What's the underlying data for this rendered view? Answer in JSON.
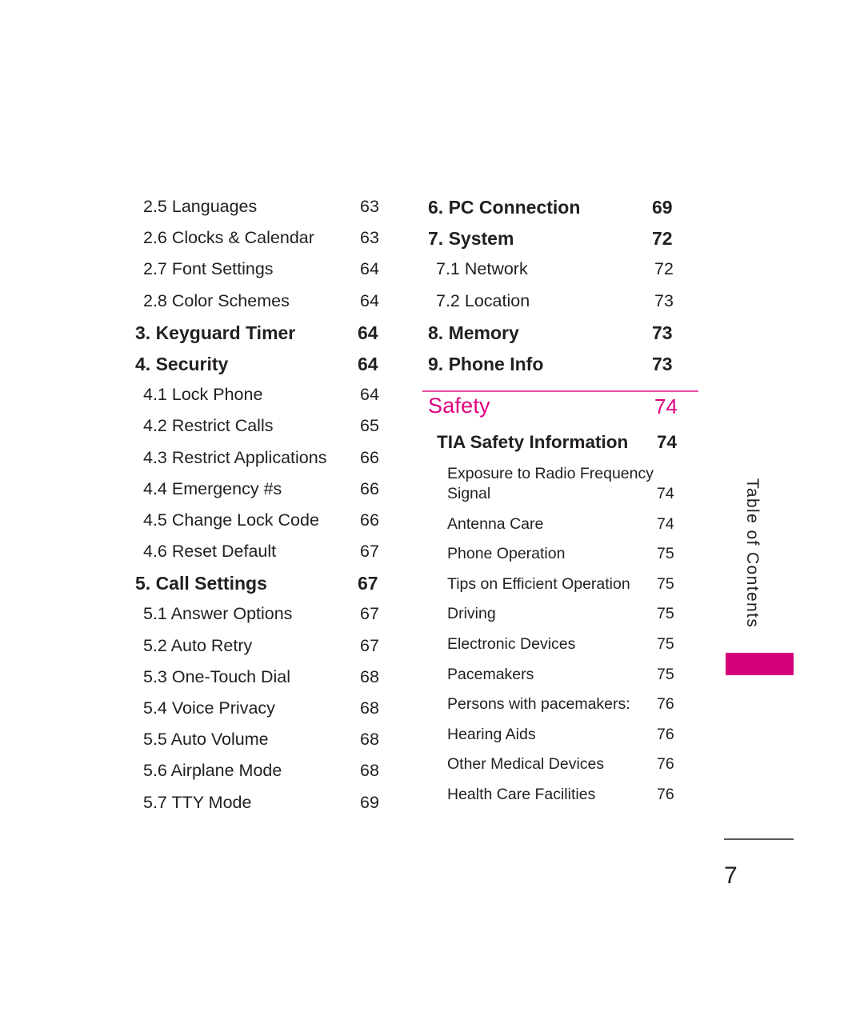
{
  "document": {
    "page_number": "7",
    "side_tab_label": "Table of Contents",
    "accent_color": "#d4007a",
    "rule_color": "#ea4ca4"
  },
  "left_column": {
    "entries": [
      {
        "label": "2.5 Languages",
        "page": "63",
        "level": 2
      },
      {
        "label": "2.6 Clocks & Calendar",
        "page": "63",
        "level": 2
      },
      {
        "label": "2.7 Font Settings",
        "page": "64",
        "level": 2
      },
      {
        "label": "2.8 Color Schemes",
        "page": "64",
        "level": 2
      },
      {
        "label": "3. Keyguard Timer",
        "page": "64",
        "level": 1
      },
      {
        "label": "4. Security",
        "page": "64",
        "level": 1
      },
      {
        "label": "4.1 Lock Phone",
        "page": "64",
        "level": 2
      },
      {
        "label": "4.2 Restrict Calls",
        "page": "65",
        "level": 2
      },
      {
        "label": "4.3 Restrict Applications",
        "page": "66",
        "level": 2
      },
      {
        "label": "4.4 Emergency #s",
        "page": "66",
        "level": 2
      },
      {
        "label": "4.5 Change Lock Code",
        "page": "66",
        "level": 2
      },
      {
        "label": "4.6 Reset Default",
        "page": "67",
        "level": 2
      },
      {
        "label": "5. Call Settings",
        "page": "67",
        "level": 1
      },
      {
        "label": "5.1 Answer Options",
        "page": "67",
        "level": 2
      },
      {
        "label": "5.2 Auto Retry",
        "page": "67",
        "level": 2
      },
      {
        "label": "5.3 One-Touch Dial",
        "page": "68",
        "level": 2
      },
      {
        "label": "5.4 Voice Privacy",
        "page": "68",
        "level": 2
      },
      {
        "label": "5.5 Auto Volume",
        "page": "68",
        "level": 2
      },
      {
        "label": "5.6 Airplane Mode",
        "page": "68",
        "level": 2
      },
      {
        "label": "5.7 TTY Mode",
        "page": "69",
        "level": 2
      }
    ]
  },
  "right_column": {
    "entries": [
      {
        "label": "6. PC Connection",
        "page": "69",
        "level": 1
      },
      {
        "label": "7. System",
        "page": "72",
        "level": 1
      },
      {
        "label": "7.1 Network",
        "page": "72",
        "level": 2
      },
      {
        "label": "7.2 Location",
        "page": "73",
        "level": 2
      },
      {
        "label": "8. Memory",
        "page": "73",
        "level": 1
      },
      {
        "label": "9. Phone Info",
        "page": "73",
        "level": 1
      }
    ]
  },
  "safety_section": {
    "title": "Safety",
    "page": "74",
    "subsection": {
      "label": "TIA Safety Information",
      "page": "74"
    },
    "entries": [
      {
        "label": "Exposure to Radio Frequency",
        "page": "",
        "tight": true
      },
      {
        "label": "Signal",
        "page": "74",
        "tight": false
      },
      {
        "label": "Antenna Care",
        "page": "74",
        "tight": false
      },
      {
        "label": "Phone Operation",
        "page": "75",
        "tight": false
      },
      {
        "label": "Tips on Efficient Operation",
        "page": "75",
        "tight": false
      },
      {
        "label": "Driving",
        "page": "75",
        "tight": false
      },
      {
        "label": "Electronic Devices",
        "page": "75",
        "tight": false
      },
      {
        "label": "Pacemakers",
        "page": "75",
        "tight": false
      },
      {
        "label": "Persons with pacemakers:",
        "page": "76",
        "tight": false
      },
      {
        "label": "Hearing Aids",
        "page": "76",
        "tight": false
      },
      {
        "label": "Other Medical Devices",
        "page": "76",
        "tight": false
      },
      {
        "label": "Health Care Facilities",
        "page": "76",
        "tight": false
      }
    ]
  }
}
